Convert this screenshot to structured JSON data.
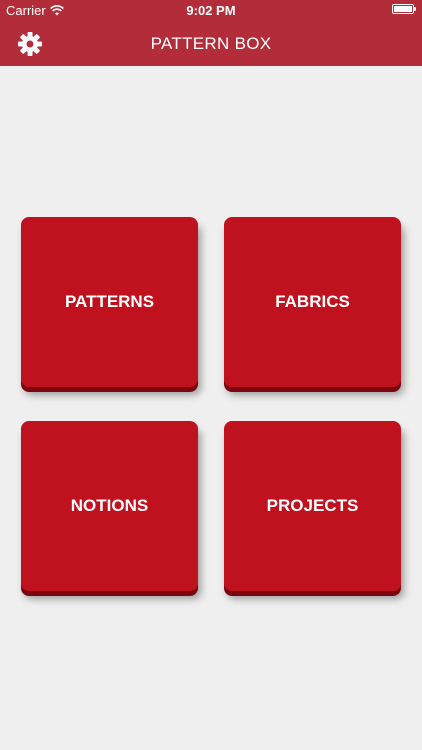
{
  "status": {
    "carrier": "Carrier",
    "time": "9:02 PM",
    "wifi_icon": "wifi-icon",
    "battery_icon": "battery-icon"
  },
  "nav": {
    "title": "PATTERN BOX",
    "settings_icon": "gear-icon"
  },
  "tiles": [
    {
      "label": "PATTERNS"
    },
    {
      "label": "FABRICS"
    },
    {
      "label": "NOTIONS"
    },
    {
      "label": "PROJECTS"
    }
  ],
  "colors": {
    "bar": "#b22d39",
    "tile": "#c0111f",
    "tile_edge": "#7a0710",
    "background": "#efefef"
  }
}
